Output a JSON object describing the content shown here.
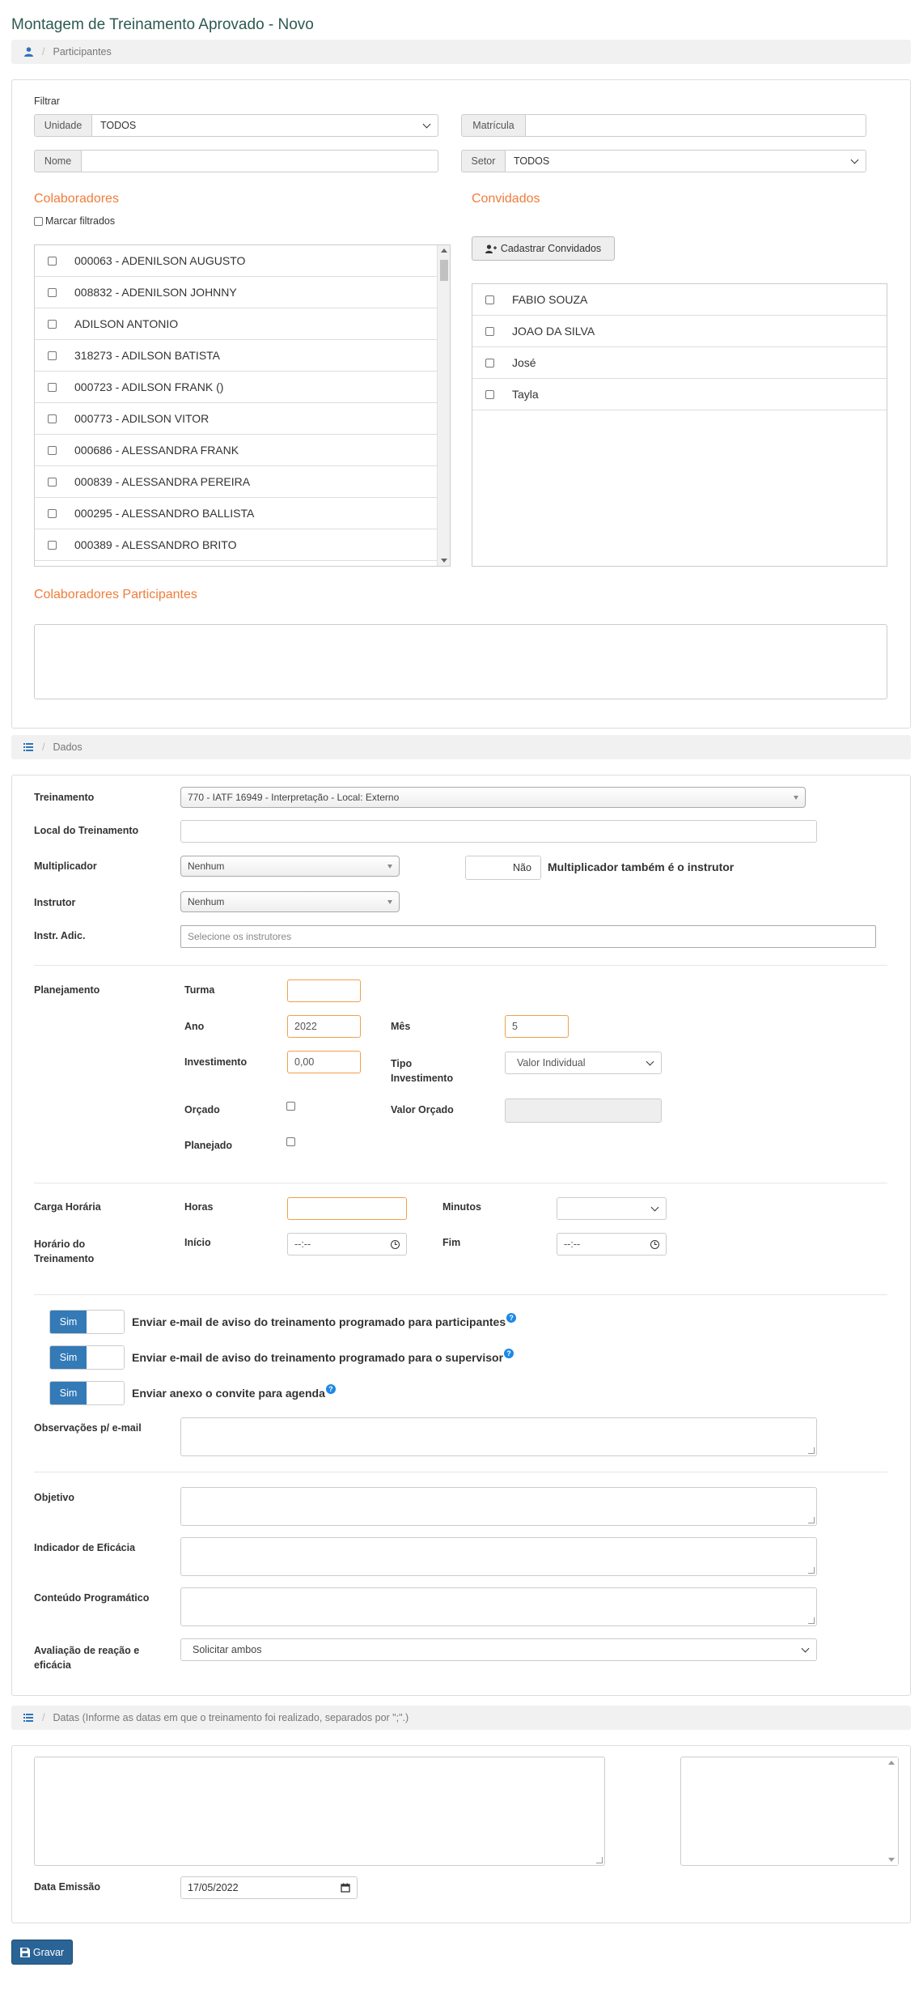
{
  "page_title": "Montagem de Treinamento Aprovado - Novo",
  "breadcrumbs": {
    "participantes": "Participantes",
    "dados": "Dados",
    "datas": "Datas (Informe as datas em que o treinamento foi realizado, separados por \";\".)",
    "separator": "/"
  },
  "filter": {
    "heading": "Filtrar",
    "unidade_label": "Unidade",
    "unidade_value": "TODOS",
    "matricula_label": "Matrícula",
    "matricula_value": "",
    "nome_label": "Nome",
    "nome_value": "",
    "setor_label": "Setor",
    "setor_value": "TODOS"
  },
  "colaboradores": {
    "heading": "Colaboradores",
    "mark_filtered": "Marcar filtrados",
    "items": [
      "000063 - ADENILSON AUGUSTO",
      "008832 - ADENILSON JOHNNY",
      "ADILSON ANTONIO",
      "318273 - ADILSON BATISTA",
      "000723 - ADILSON FRANK ()",
      "000773 - ADILSON VITOR",
      "000686 - ALESSANDRA FRANK",
      "000839 - ALESSANDRA PEREIRA",
      "000295 - ALESSANDRO BALLISTA",
      "000389 - ALESSANDRO BRITO"
    ]
  },
  "convidados": {
    "heading": "Convidados",
    "register_button": "Cadastrar Convidados",
    "items": [
      "FABIO SOUZA",
      "JOAO DA SILVA",
      "José",
      "Tayla"
    ]
  },
  "participantes": {
    "heading": "Colaboradores Participantes"
  },
  "dados": {
    "treinamento_label": "Treinamento",
    "treinamento_value": "770 - IATF 16949 - Interpretação - Local: Externo",
    "local_label": "Local do Treinamento",
    "local_value": "",
    "multiplicador_label": "Multiplicador",
    "multiplicador_value": "Nenhum",
    "toggle_nao": "Não",
    "multiplicador_instrutor_label": "Multiplicador também é o instrutor",
    "instrutor_label": "Instrutor",
    "instrutor_value": "Nenhum",
    "instr_adic_label": "Instr. Adic.",
    "instr_adic_placeholder": "Selecione os instrutores",
    "planejamento_label": "Planejamento",
    "turma_label": "Turma",
    "turma_value": "",
    "ano_label": "Ano",
    "ano_value": "2022",
    "mes_label": "Mês",
    "mes_value": "5",
    "investimento_label": "Investimento",
    "investimento_value": "0,00",
    "tipo_investimento_label_1": "Tipo",
    "tipo_investimento_label_2": "Investimento",
    "tipo_investimento_value": "Valor Individual",
    "orcado_label": "Orçado",
    "valor_orcado_label": "Valor Orçado",
    "planejado_label": "Planejado",
    "carga_horaria_label": "Carga Horária",
    "horas_label": "Horas",
    "minutos_label": "Minutos",
    "horario_label_1": "Horário do",
    "horario_label_2": "Treinamento",
    "inicio_label": "Início",
    "inicio_value": "--:--",
    "fim_label": "Fim",
    "fim_value": "--:--",
    "sim": "Sim",
    "email_participantes": "Enviar e-mail de aviso do treinamento programado para participantes",
    "email_supervisor": "Enviar e-mail de aviso do treinamento programado para o supervisor",
    "anexo_convite": "Enviar anexo o convite para agenda",
    "help_glyph": "?",
    "observacoes_label": "Observações p/ e-mail",
    "objetivo_label": "Objetivo",
    "indicador_label": "Indicador de Eficácia",
    "conteudo_label": "Conteúdo Programático",
    "avaliacao_label_1": "Avaliação de reação e",
    "avaliacao_label_2": "eficácia",
    "avaliacao_value": "Solicitar ambos"
  },
  "datas": {
    "data_emissao_label": "Data Emissão",
    "data_emissao_value": "17/05/2022"
  },
  "save_button": "Gravar",
  "colors": {
    "accent_orange": "#ef7d3c",
    "primary_blue": "#337ab7",
    "title_green": "#2d5a52"
  }
}
